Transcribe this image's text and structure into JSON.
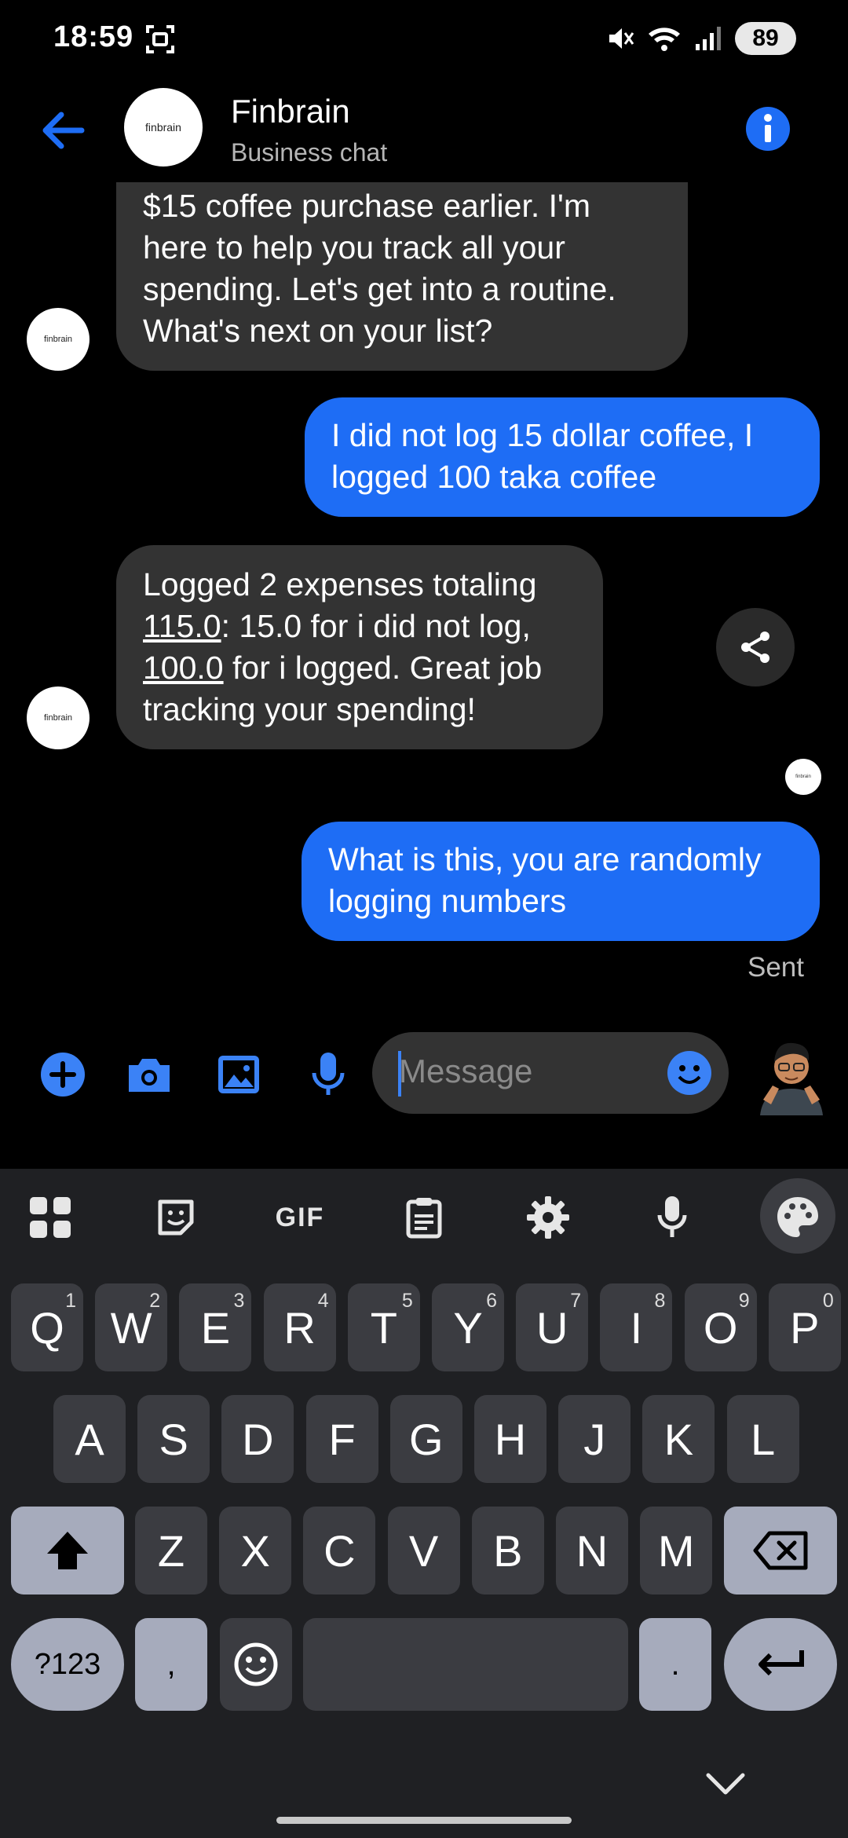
{
  "status_bar": {
    "time": "18:59",
    "battery": "89"
  },
  "header": {
    "title": "Finbrain",
    "subtitle": "Business chat",
    "avatar_text": "finbrain"
  },
  "messages": {
    "m1": {
      "text": "$15 coffee purchase earlier. I'm here to help you track all your spending. Let's get into a routine. What's next on your list?",
      "avatar_text": "finbrain"
    },
    "m2": {
      "text": "I did not log 15 dollar coffee, I logged 100 taka coffee"
    },
    "m3": {
      "part1": "Logged 2 expenses totaling ",
      "link1": "115.0",
      "part2": ": 15.0 for i did not log, ",
      "link2": "100.0",
      "part3": " for i logged. Great job tracking your spending!",
      "avatar_text": "finbrain"
    },
    "m4": {
      "text": "What is this, you are randomly logging numbers"
    }
  },
  "read_receipt": {
    "avatar_text": "finbrain"
  },
  "sent_status": "Sent",
  "composer": {
    "placeholder": "Message"
  },
  "keyboard": {
    "row1": [
      {
        "k": "Q",
        "h": "1"
      },
      {
        "k": "W",
        "h": "2"
      },
      {
        "k": "E",
        "h": "3"
      },
      {
        "k": "R",
        "h": "4"
      },
      {
        "k": "T",
        "h": "5"
      },
      {
        "k": "Y",
        "h": "6"
      },
      {
        "k": "U",
        "h": "7"
      },
      {
        "k": "I",
        "h": "8"
      },
      {
        "k": "O",
        "h": "9"
      },
      {
        "k": "P",
        "h": "0"
      }
    ],
    "row2": [
      "A",
      "S",
      "D",
      "F",
      "G",
      "H",
      "J",
      "K",
      "L"
    ],
    "row3": [
      "Z",
      "X",
      "C",
      "V",
      "B",
      "N",
      "M"
    ],
    "symbols_label": "?123",
    "comma": ",",
    "period": ".",
    "gif_label": "GIF"
  },
  "colors": {
    "accent": "#1e6df5",
    "icon_blue": "#3b82f6",
    "bubble_in": "#333333"
  }
}
